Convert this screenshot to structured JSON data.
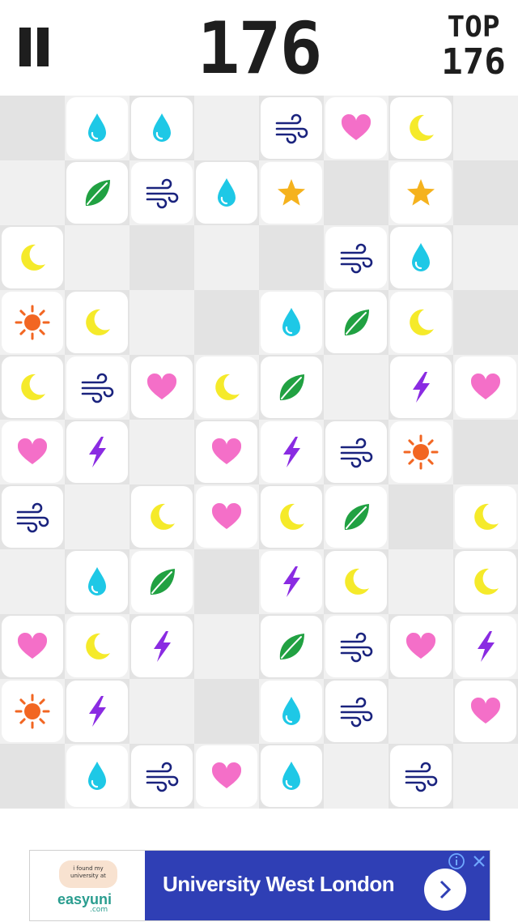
{
  "header": {
    "score": "176",
    "top_label": "TOP",
    "top_value": "176"
  },
  "board": {
    "columns": 8,
    "rows": 11,
    "tiles": [
      [
        null,
        "drop",
        "drop",
        null,
        "wind",
        "heart",
        "moon",
        null
      ],
      [
        null,
        "leaf",
        "wind",
        "drop",
        "star",
        null,
        "star",
        null
      ],
      [
        "moon",
        null,
        null,
        null,
        null,
        "wind",
        "drop",
        null
      ],
      [
        "sun",
        "moon",
        null,
        null,
        "drop",
        "leaf",
        "moon",
        null
      ],
      [
        "moon",
        "wind",
        "heart",
        "moon",
        "leaf",
        null,
        "bolt",
        "heart"
      ],
      [
        "heart",
        "bolt",
        null,
        "heart",
        "bolt",
        "wind",
        "sun",
        null
      ],
      [
        "wind",
        null,
        "moon",
        "heart",
        "moon",
        "leaf",
        null,
        "moon"
      ],
      [
        null,
        "drop",
        "leaf",
        null,
        "bolt",
        "moon",
        null,
        "moon"
      ],
      [
        "heart",
        "moon",
        "bolt",
        null,
        "leaf",
        "wind",
        "heart",
        "bolt"
      ],
      [
        "sun",
        "bolt",
        null,
        null,
        "drop",
        "wind",
        null,
        "heart"
      ],
      [
        null,
        "drop",
        "wind",
        "heart",
        "drop",
        null,
        "wind",
        null
      ]
    ],
    "icon_colors": {
      "drop": "#1ec8e6",
      "wind": "#1a237e",
      "heart": "#f46fc8",
      "moon": "#f5ea2a",
      "leaf": "#21a142",
      "star": "#f5b21d",
      "sun": "#f26622",
      "bolt": "#8a2be2"
    }
  },
  "ad": {
    "bubble_text": "i found my university at",
    "brand": "easyuni",
    "brand_sub": ".com",
    "title": "University West London"
  }
}
